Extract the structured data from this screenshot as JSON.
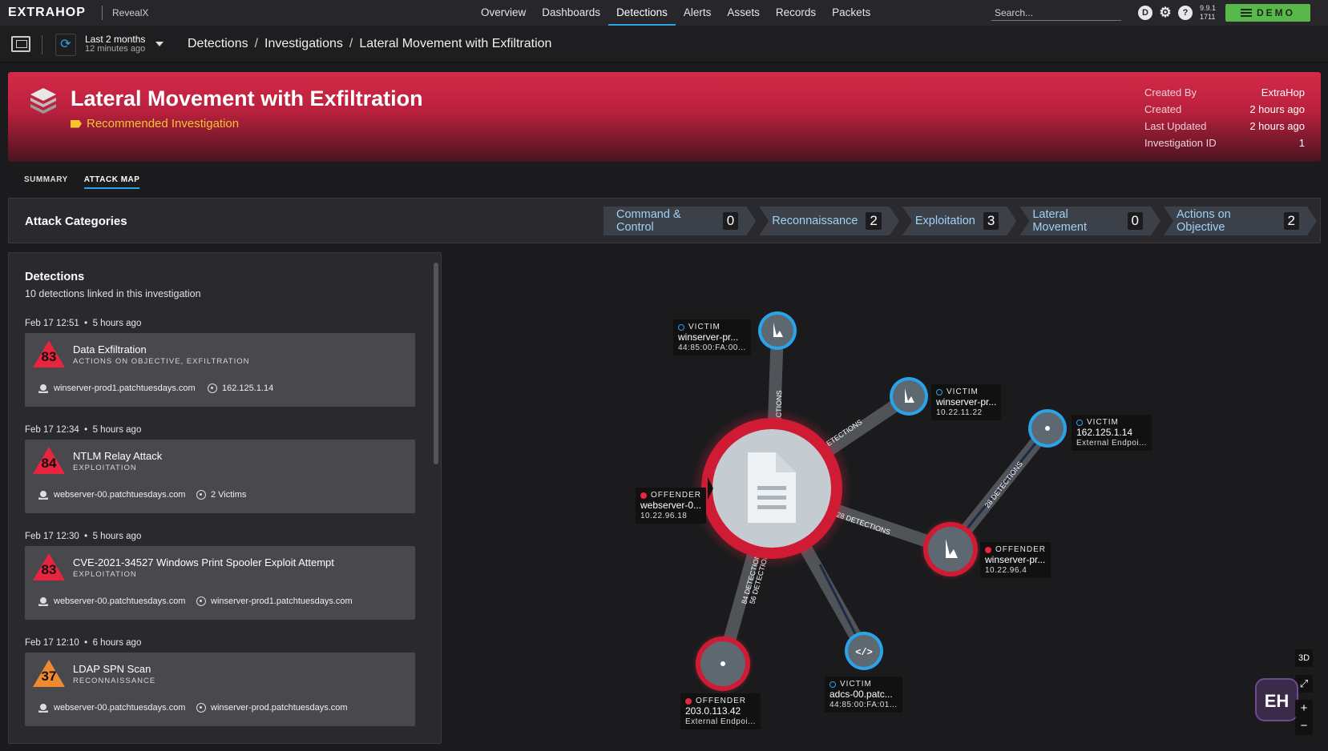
{
  "nav": {
    "logo": "EXTRAHOP",
    "product": "RevealX",
    "links": [
      "Overview",
      "Dashboards",
      "Detections",
      "Alerts",
      "Assets",
      "Records",
      "Packets"
    ],
    "active_link": "Detections",
    "search_placeholder": "Search...",
    "user_initial": "D",
    "version_line1": "9.9.1",
    "version_line2": "1711",
    "demo_label": "DEMO",
    "colors": {
      "accent": "#2aa4e8",
      "demo": "#58b94a"
    }
  },
  "subbar": {
    "time_range": "Last 2 months",
    "time_ago": "12 minutes ago",
    "breadcrumb": [
      "Detections",
      "Investigations",
      "Lateral Movement with Exfiltration"
    ]
  },
  "banner": {
    "title": "Lateral Movement with Exfiltration",
    "tag": "Recommended Investigation",
    "meta": [
      {
        "key": "Created By",
        "value": "ExtraHop"
      },
      {
        "key": "Created",
        "value": "2 hours ago"
      },
      {
        "key": "Last Updated",
        "value": "2 hours ago"
      },
      {
        "key": "Investigation ID",
        "value": "1"
      }
    ],
    "color": "#d42a48"
  },
  "tabs": [
    "SUMMARY",
    "ATTACK MAP"
  ],
  "active_tab": "ATTACK MAP",
  "attack_categories": {
    "title": "Attack Categories",
    "items": [
      {
        "label": "Command & Control",
        "count": "0"
      },
      {
        "label": "Reconnaissance",
        "count": "2"
      },
      {
        "label": "Exploitation",
        "count": "3"
      },
      {
        "label": "Lateral Movement",
        "count": "0"
      },
      {
        "label": "Actions on Objective",
        "count": "2"
      }
    ]
  },
  "detections": {
    "title": "Detections",
    "subtitle": "10 detections linked in this investigation",
    "items": [
      {
        "date": "Feb 17 12:51",
        "ago": "5 hours ago",
        "score": "83",
        "score_color": "#e8243f",
        "title": "Data Exfiltration",
        "category": "ACTIONS ON OBJECTIVE, EXFILTRATION",
        "offender": "winserver-prod1.patchtuesdays.com",
        "victim": "162.125.1.14"
      },
      {
        "date": "Feb 17 12:34",
        "ago": "5 hours ago",
        "score": "84",
        "score_color": "#e8243f",
        "title": "NTLM Relay Attack",
        "category": "EXPLOITATION",
        "offender": "webserver-00.patchtuesdays.com",
        "victim": "2 Victims"
      },
      {
        "date": "Feb 17 12:30",
        "ago": "5 hours ago",
        "score": "83",
        "score_color": "#e8243f",
        "title": "CVE-2021-34527 Windows Print Spooler Exploit Attempt",
        "category": "EXPLOITATION",
        "offender": "webserver-00.patchtuesdays.com",
        "victim": "winserver-prod1.patchtuesdays.com"
      },
      {
        "date": "Feb 17 12:10",
        "ago": "6 hours ago",
        "score": "37",
        "score_color": "#f08a30",
        "title": "LDAP SPN Scan",
        "category": "RECONNAISSANCE",
        "offender": "webserver-00.patchtuesdays.com",
        "victim": "winserver-prod.patchtuesdays.com"
      }
    ]
  },
  "attack_map": {
    "edges": [
      {
        "label": "28 DETECTIONS"
      },
      {
        "label": "56 DETECTIONS"
      },
      {
        "label": "28 DETECTIONS"
      },
      {
        "label": "28 DETECTIONS"
      },
      {
        "label": "84 DETECTIONS"
      },
      {
        "label": "56 DETECTIONS"
      }
    ],
    "nodes": [
      {
        "role": "VICTIM",
        "host": "winserver-pr...",
        "addr": "44:85:00:FA:00..."
      },
      {
        "role": "VICTIM",
        "host": "winserver-pr...",
        "addr": "10.22.11.22"
      },
      {
        "role": "VICTIM",
        "host": "162.125.1.14",
        "addr": "External Endpoi..."
      },
      {
        "role": "OFFENDER",
        "host": "webserver-0...",
        "addr": "10.22.96.18"
      },
      {
        "role": "OFFENDER",
        "host": "winserver-pr...",
        "addr": "10.22.96.4"
      },
      {
        "role": "OFFENDER",
        "host": "203.0.113.42",
        "addr": "External Endpoi..."
      },
      {
        "role": "VICTIM",
        "host": "adcs-00.patc...",
        "addr": "44:85:00:FA:01..."
      }
    ],
    "controls": {
      "view_3d": "3D",
      "zoom_in": "+",
      "zoom_out": "−"
    },
    "badge": "EH"
  }
}
